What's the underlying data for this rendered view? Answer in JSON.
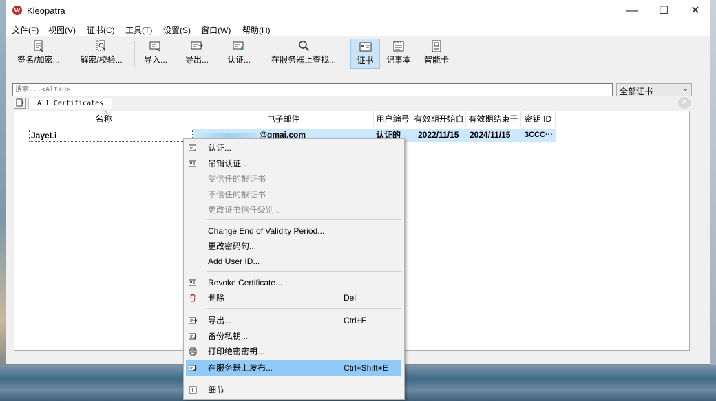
{
  "window": {
    "title": "Kleopatra",
    "controls": {
      "minimize": "—",
      "maximize": "☐",
      "close": "✕"
    }
  },
  "menu": [
    "文件(F)",
    "视图(V)",
    "证书(C)",
    "工具(T)",
    "设置(S)",
    "窗口(W)",
    "帮助(H)"
  ],
  "toolbar": {
    "sign_encrypt": "签名/加密...",
    "decrypt_verify": "解密/校验...",
    "import": "导入...",
    "export": "导出...",
    "certify": "认证...",
    "lookup_server": "在服务器上查找...",
    "certificates": "证书",
    "notepad": "记事本",
    "smartcard": "智能卡"
  },
  "search": {
    "placeholder": "搜索...<Alt+Q>",
    "filter_selected": "全部证书"
  },
  "tabs": {
    "active": "All Certificates"
  },
  "table": {
    "headers": [
      "名称",
      "电子邮件",
      "用户编号",
      "有效期开始自",
      "有效期结束于",
      "密钥 ID"
    ],
    "rows": [
      {
        "name": "JayeLi",
        "email": "@gmai.com",
        "user_id": "认证的",
        "valid_from": "2022/11/15",
        "valid_until": "2024/11/15",
        "key_id": "3CCC···"
      }
    ]
  },
  "context_menu": {
    "certify": "认证...",
    "revoke_certification": "吊销认证...",
    "trust_root": "受信任的根证书",
    "distrust_root": "不信任的根证书",
    "change_trust_level": "更改证书信任级别...",
    "change_expiry": "Change End of Validity Period...",
    "change_passphrase": "更改密码句...",
    "add_user_id": "Add User ID...",
    "revoke_certificate": "Revoke Certificate...",
    "delete": "删除",
    "delete_shortcut": "Del",
    "export": "导出...",
    "export_shortcut": "Ctrl+E",
    "backup_secret": "备份私钥...",
    "print_secret": "打印绝密密钥...",
    "publish_server": "在服务器上发布...",
    "publish_shortcut": "Ctrl+Shift+E",
    "details": "细节"
  },
  "colors": {
    "highlight": "#91c9f7",
    "row_selection": "#cce8ff",
    "app_icon": "#c0262d"
  }
}
